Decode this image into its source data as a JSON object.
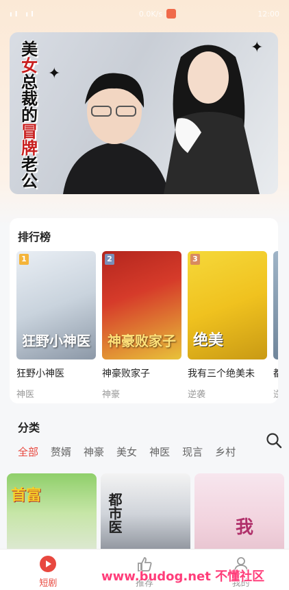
{
  "status_bar": {
    "signal": "ıl ıl",
    "net": "0.0K/s",
    "time": "12:00"
  },
  "banner": {
    "title_chars": [
      "美",
      "女",
      "总",
      "裁",
      "的",
      "冒",
      "牌",
      "老",
      "公"
    ]
  },
  "ranking": {
    "title": "排行榜",
    "items": [
      {
        "rank": "1",
        "name": "狂野小神医",
        "tag": "神医",
        "poster_text": "狂野小神医",
        "rank_color": "#f4b43a"
      },
      {
        "rank": "2",
        "name": "神豪败家子",
        "tag": "神豪",
        "poster_text": "神豪败家子",
        "rank_color": "#7a8fb8"
      },
      {
        "rank": "3",
        "name": "我有三个绝美未",
        "tag": "逆袭",
        "poster_text": "绝美",
        "rank_color": "#d98a5e"
      },
      {
        "rank": "",
        "name": "都",
        "tag": "逆",
        "poster_text": "",
        "rank_color": "#999"
      }
    ]
  },
  "category": {
    "title": "分类",
    "tabs": [
      "全部",
      "赘婿",
      "神豪",
      "美女",
      "神医",
      "现言",
      "乡村"
    ],
    "active_tab": "全部"
  },
  "grid": [
    {
      "text": "首富"
    },
    {
      "text": "都市医"
    },
    {
      "text": "我"
    }
  ],
  "tab_bar": {
    "items": [
      {
        "label": "短剧",
        "icon": "play-circle-icon",
        "active": true
      },
      {
        "label": "推荐",
        "icon": "thumb-icon",
        "active": false
      },
      {
        "label": "我的",
        "icon": "user-icon",
        "active": false
      }
    ]
  },
  "watermark": "www.budog.net 不懂社区",
  "colors": {
    "accent": "#e8483f"
  }
}
